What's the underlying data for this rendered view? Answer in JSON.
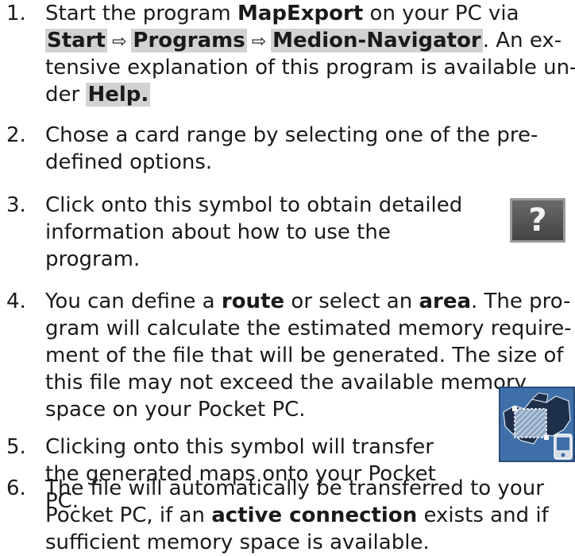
{
  "steps": [
    {
      "number": "1.",
      "line1": {
        "t1": "Start the program ",
        "b1": "MapExport",
        "t2": " on your PC via"
      },
      "line2": {
        "p1": "Start",
        "arrow1": "⇨",
        "p2": "Programs",
        "arrow2": "⇨",
        "p3": "Medion-Navigator",
        "t1": ". An ex-"
      },
      "line3": "tensive explanation of this program is available un-",
      "line4": {
        "t1": "der ",
        "p1": "Help."
      }
    },
    {
      "number": "2.",
      "lines": [
        "Chose a card range by selecting one of the pre-",
        "defined options."
      ]
    },
    {
      "number": "3.",
      "lines": [
        "Click onto this symbol to obtain detailed",
        "information about how to use the",
        "program."
      ],
      "icon_glyph": "?"
    },
    {
      "number": "4.",
      "line1": {
        "t1": "You can define a ",
        "b1": "route",
        "t2": " or select an ",
        "b2": "area",
        "t3": ". The pro-"
      },
      "lines": [
        "gram will calculate the estimated memory require-",
        "ment of the file that will be generated. The size of",
        "this file may not exceed the available memory",
        "space on your Pocket PC."
      ]
    },
    {
      "number": "5.",
      "lines": [
        "Clicking onto this symbol will transfer",
        "the generated maps onto your Pocket",
        "PC."
      ]
    },
    {
      "number": "6.",
      "line1": "The file will automatically be transferred to your",
      "line2": {
        "t1": "Pocket PC, if an ",
        "b1": "active connection",
        "t2": " exists and if"
      },
      "line3": "sufficient memory space is available."
    }
  ],
  "colors": {
    "highlight": "#d2d2d2",
    "help_icon_bg": "#555555",
    "map_icon_bg": "#3f6fa8"
  },
  "icons": {
    "help": "question-mark-icon",
    "transfer": "map-transfer-icon"
  }
}
